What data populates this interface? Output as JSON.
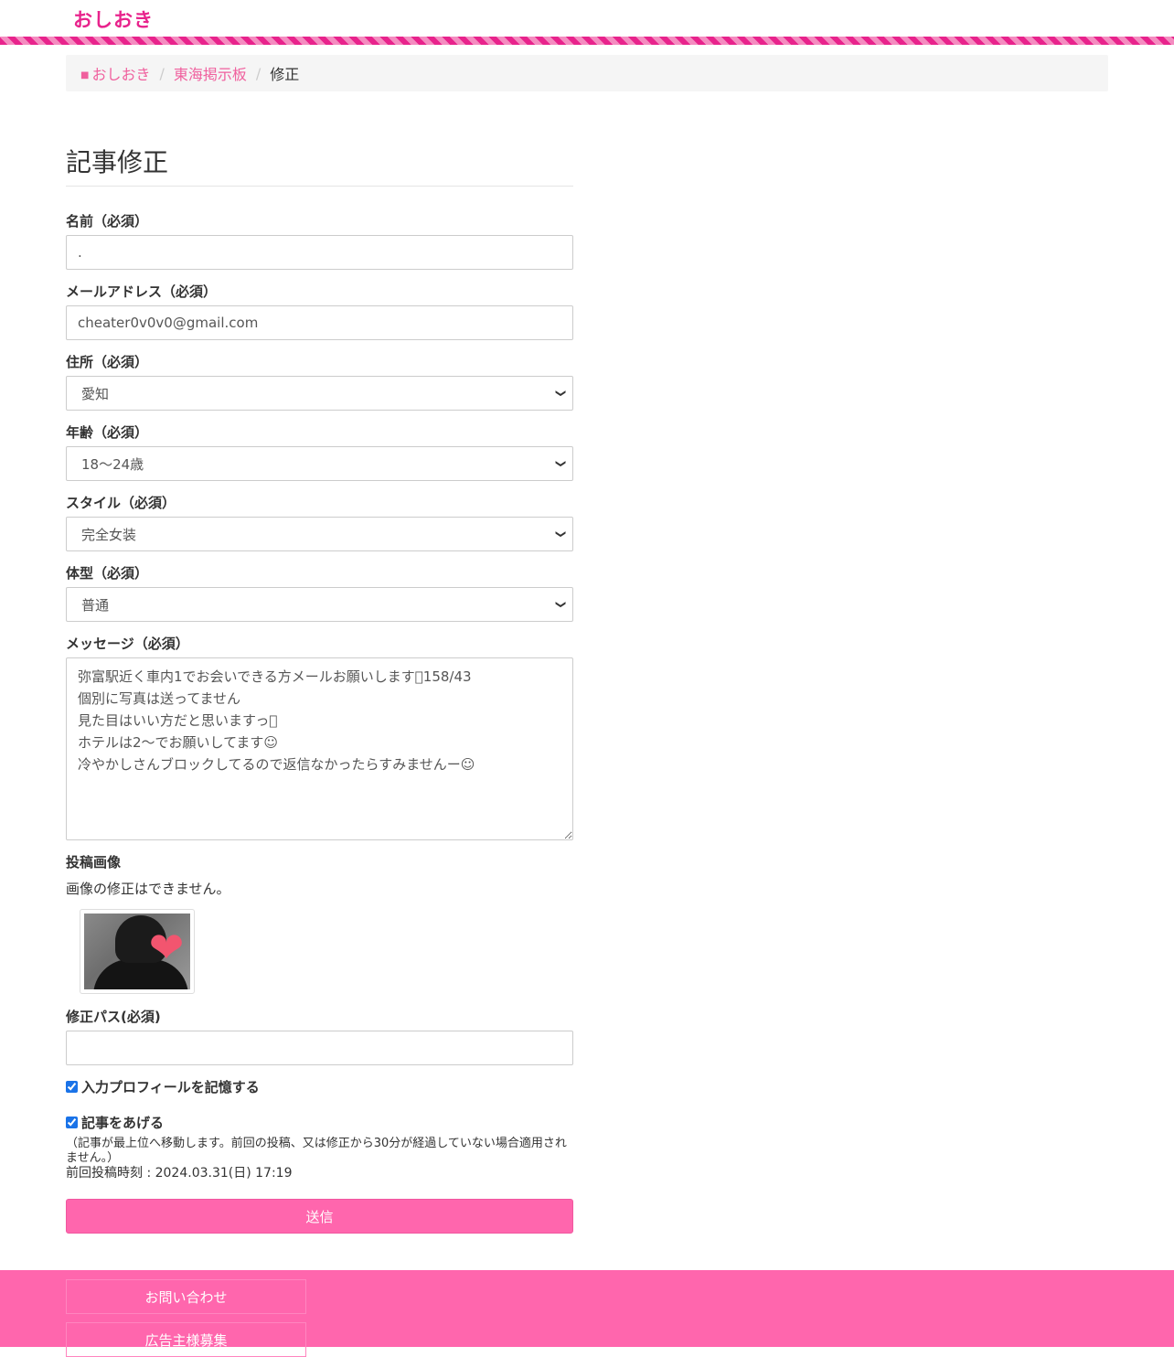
{
  "header": {
    "logo": "おしおき"
  },
  "breadcrumb": {
    "home": "おしおき",
    "board": "東海掲示板",
    "current": "修正"
  },
  "page": {
    "title": "記事修正"
  },
  "form": {
    "name": {
      "label": "名前（必須）",
      "value": "."
    },
    "email": {
      "label": "メールアドレス（必須）",
      "value": "cheater0v0v0@gmail.com"
    },
    "address": {
      "label": "住所（必須）",
      "value": "愛知"
    },
    "age": {
      "label": "年齢（必須）",
      "value": "18〜24歳"
    },
    "style": {
      "label": "スタイル（必須）",
      "value": "完全女装"
    },
    "body_type": {
      "label": "体型（必須）",
      "value": "普通"
    },
    "message": {
      "label": "メッセージ（必須）",
      "value": "弥富駅近く車内1でお会いできる方メールお願いします􏰀158/43\n個別に写真は送ってません\n見た目はいい方だと思いますっ􏰀\nホテルは2〜でお願いしてます☺︎\n冷やかしさんブロックしてるので返信なかったらすみませんー☺︎"
    },
    "image": {
      "label": "投稿画像",
      "note": "画像の修正はできません。"
    },
    "edit_pass": {
      "label": "修正パス(必須)",
      "value": ""
    },
    "remember": {
      "label": "入力プロフィールを記憶する",
      "checked": true
    },
    "bump": {
      "label": "記事をあげる",
      "checked": true,
      "note": "（記事が最上位へ移動します。前回の投稿、又は修正から30分が経過していない場合適用されません。）",
      "last_post": "前回投稿時刻 : 2024.03.31(日) 17:19"
    },
    "submit_label": "送信"
  },
  "footer": {
    "contact": "お問い合わせ",
    "advertisers": "広告主様募集"
  },
  "icons": {
    "home": "home-icon",
    "select_arrow": "chevron-down-icon"
  },
  "colors": {
    "brand": "#e8238c",
    "accent": "#ff66ad",
    "link": "#f0609e"
  }
}
